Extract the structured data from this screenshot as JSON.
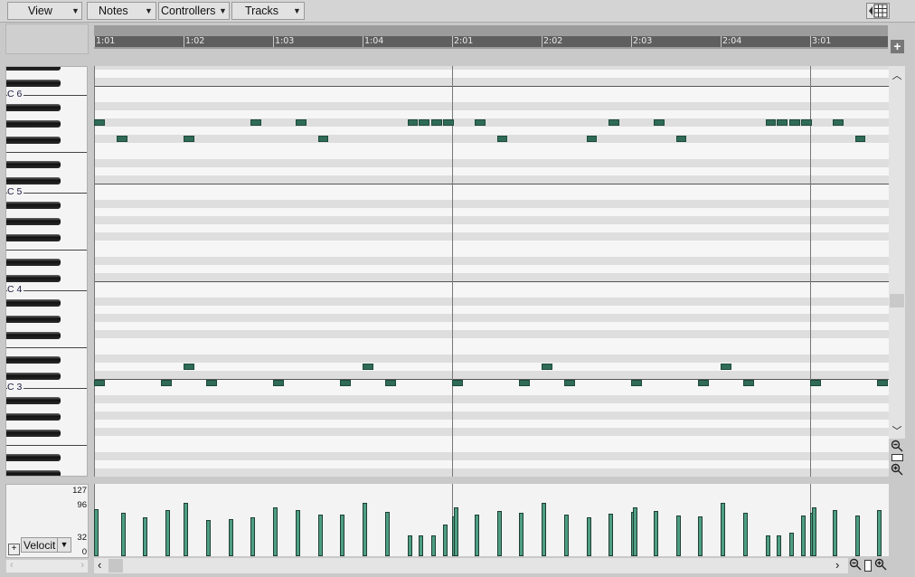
{
  "menus": [
    {
      "label": "View"
    },
    {
      "label": "Notes"
    },
    {
      "label": "Controllers"
    },
    {
      "label": "Tracks"
    }
  ],
  "ruler": {
    "labels": [
      "1:01",
      "1:02",
      "1:03",
      "1:04",
      "2:01",
      "2:02",
      "2:03",
      "2:04",
      "3:01"
    ]
  },
  "keyboard": {
    "octave_labels": [
      "C 6",
      "C 5",
      "C 4",
      "C 3"
    ]
  },
  "notes": [
    {
      "pitch": "G#5",
      "start_beat": 1.0,
      "length_beats": 0.12
    },
    {
      "pitch": "F#5",
      "start_beat": 1.25,
      "length_beats": 0.12
    },
    {
      "pitch": "F#5",
      "start_beat": 2.0,
      "length_beats": 0.12
    },
    {
      "pitch": "G#5",
      "start_beat": 2.75,
      "length_beats": 0.12
    },
    {
      "pitch": "G#5",
      "start_beat": 3.25,
      "length_beats": 0.12
    },
    {
      "pitch": "F#5",
      "start_beat": 3.5,
      "length_beats": 0.12
    },
    {
      "pitch": "G#5",
      "start_beat": 4.5,
      "length_beats": 0.12
    },
    {
      "pitch": "G#5",
      "start_beat": 4.63,
      "length_beats": 0.12
    },
    {
      "pitch": "G#5",
      "start_beat": 4.77,
      "length_beats": 0.12
    },
    {
      "pitch": "G#5",
      "start_beat": 4.9,
      "length_beats": 0.12
    },
    {
      "pitch": "G#5",
      "start_beat": 5.25,
      "length_beats": 0.12
    },
    {
      "pitch": "F#5",
      "start_beat": 5.5,
      "length_beats": 0.12
    },
    {
      "pitch": "F#5",
      "start_beat": 6.5,
      "length_beats": 0.12
    },
    {
      "pitch": "G#5",
      "start_beat": 6.75,
      "length_beats": 0.12
    },
    {
      "pitch": "G#5",
      "start_beat": 7.25,
      "length_beats": 0.12
    },
    {
      "pitch": "F#5",
      "start_beat": 7.5,
      "length_beats": 0.12
    },
    {
      "pitch": "G#5",
      "start_beat": 8.5,
      "length_beats": 0.12
    },
    {
      "pitch": "G#5",
      "start_beat": 8.63,
      "length_beats": 0.12
    },
    {
      "pitch": "G#5",
      "start_beat": 8.77,
      "length_beats": 0.12
    },
    {
      "pitch": "G#5",
      "start_beat": 8.9,
      "length_beats": 0.12
    },
    {
      "pitch": "G#5",
      "start_beat": 9.25,
      "length_beats": 0.12
    },
    {
      "pitch": "F#5",
      "start_beat": 9.5,
      "length_beats": 0.12
    },
    {
      "pitch": "D3",
      "start_beat": 2.0,
      "length_beats": 0.12
    },
    {
      "pitch": "D3",
      "start_beat": 4.0,
      "length_beats": 0.12
    },
    {
      "pitch": "D3",
      "start_beat": 6.0,
      "length_beats": 0.12
    },
    {
      "pitch": "D3",
      "start_beat": 8.0,
      "length_beats": 0.12
    },
    {
      "pitch": "C3",
      "start_beat": 1.0,
      "length_beats": 0.12
    },
    {
      "pitch": "C3",
      "start_beat": 1.75,
      "length_beats": 0.12
    },
    {
      "pitch": "C3",
      "start_beat": 2.25,
      "length_beats": 0.12
    },
    {
      "pitch": "C3",
      "start_beat": 3.0,
      "length_beats": 0.12
    },
    {
      "pitch": "C3",
      "start_beat": 3.75,
      "length_beats": 0.12
    },
    {
      "pitch": "C3",
      "start_beat": 4.25,
      "length_beats": 0.12
    },
    {
      "pitch": "C3",
      "start_beat": 5.0,
      "length_beats": 0.12
    },
    {
      "pitch": "C3",
      "start_beat": 5.75,
      "length_beats": 0.12
    },
    {
      "pitch": "C3",
      "start_beat": 6.25,
      "length_beats": 0.12
    },
    {
      "pitch": "C3",
      "start_beat": 7.0,
      "length_beats": 0.12
    },
    {
      "pitch": "C3",
      "start_beat": 7.75,
      "length_beats": 0.12
    },
    {
      "pitch": "C3",
      "start_beat": 8.25,
      "length_beats": 0.12
    },
    {
      "pitch": "C3",
      "start_beat": 9.0,
      "length_beats": 0.12
    },
    {
      "pitch": "C3",
      "start_beat": 9.75,
      "length_beats": 0.12
    }
  ],
  "velocity": {
    "scale_labels": [
      "127",
      "96",
      "32",
      "0"
    ],
    "selector_label": "Velocit",
    "bars": [
      {
        "beat": 1.0,
        "v": 104
      },
      {
        "beat": 1.3,
        "v": 96
      },
      {
        "beat": 1.55,
        "v": 85
      },
      {
        "beat": 1.8,
        "v": 101
      },
      {
        "beat": 2.0,
        "v": 118
      },
      {
        "beat": 2.25,
        "v": 80
      },
      {
        "beat": 2.5,
        "v": 82
      },
      {
        "beat": 2.75,
        "v": 86
      },
      {
        "beat": 3.0,
        "v": 108
      },
      {
        "beat": 3.25,
        "v": 101
      },
      {
        "beat": 3.5,
        "v": 92
      },
      {
        "beat": 3.75,
        "v": 92
      },
      {
        "beat": 4.0,
        "v": 117
      },
      {
        "beat": 4.25,
        "v": 97
      },
      {
        "beat": 4.5,
        "v": 45
      },
      {
        "beat": 4.63,
        "v": 45
      },
      {
        "beat": 4.77,
        "v": 45
      },
      {
        "beat": 4.9,
        "v": 70
      },
      {
        "beat": 5.0,
        "v": 87
      },
      {
        "beat": 5.02,
        "v": 107
      },
      {
        "beat": 5.25,
        "v": 92
      },
      {
        "beat": 5.5,
        "v": 100
      },
      {
        "beat": 5.75,
        "v": 96
      },
      {
        "beat": 6.0,
        "v": 118
      },
      {
        "beat": 6.25,
        "v": 91
      },
      {
        "beat": 6.5,
        "v": 85
      },
      {
        "beat": 6.75,
        "v": 93
      },
      {
        "beat": 7.0,
        "v": 97
      },
      {
        "beat": 7.02,
        "v": 107
      },
      {
        "beat": 7.25,
        "v": 99
      },
      {
        "beat": 7.5,
        "v": 90
      },
      {
        "beat": 7.75,
        "v": 87
      },
      {
        "beat": 8.0,
        "v": 118
      },
      {
        "beat": 8.25,
        "v": 95
      },
      {
        "beat": 8.5,
        "v": 46
      },
      {
        "beat": 8.63,
        "v": 45
      },
      {
        "beat": 8.77,
        "v": 52
      },
      {
        "beat": 8.9,
        "v": 90
      },
      {
        "beat": 9.0,
        "v": 96
      },
      {
        "beat": 9.02,
        "v": 107
      },
      {
        "beat": 9.25,
        "v": 102
      },
      {
        "beat": 9.5,
        "v": 89
      },
      {
        "beat": 9.75,
        "v": 102
      }
    ]
  }
}
